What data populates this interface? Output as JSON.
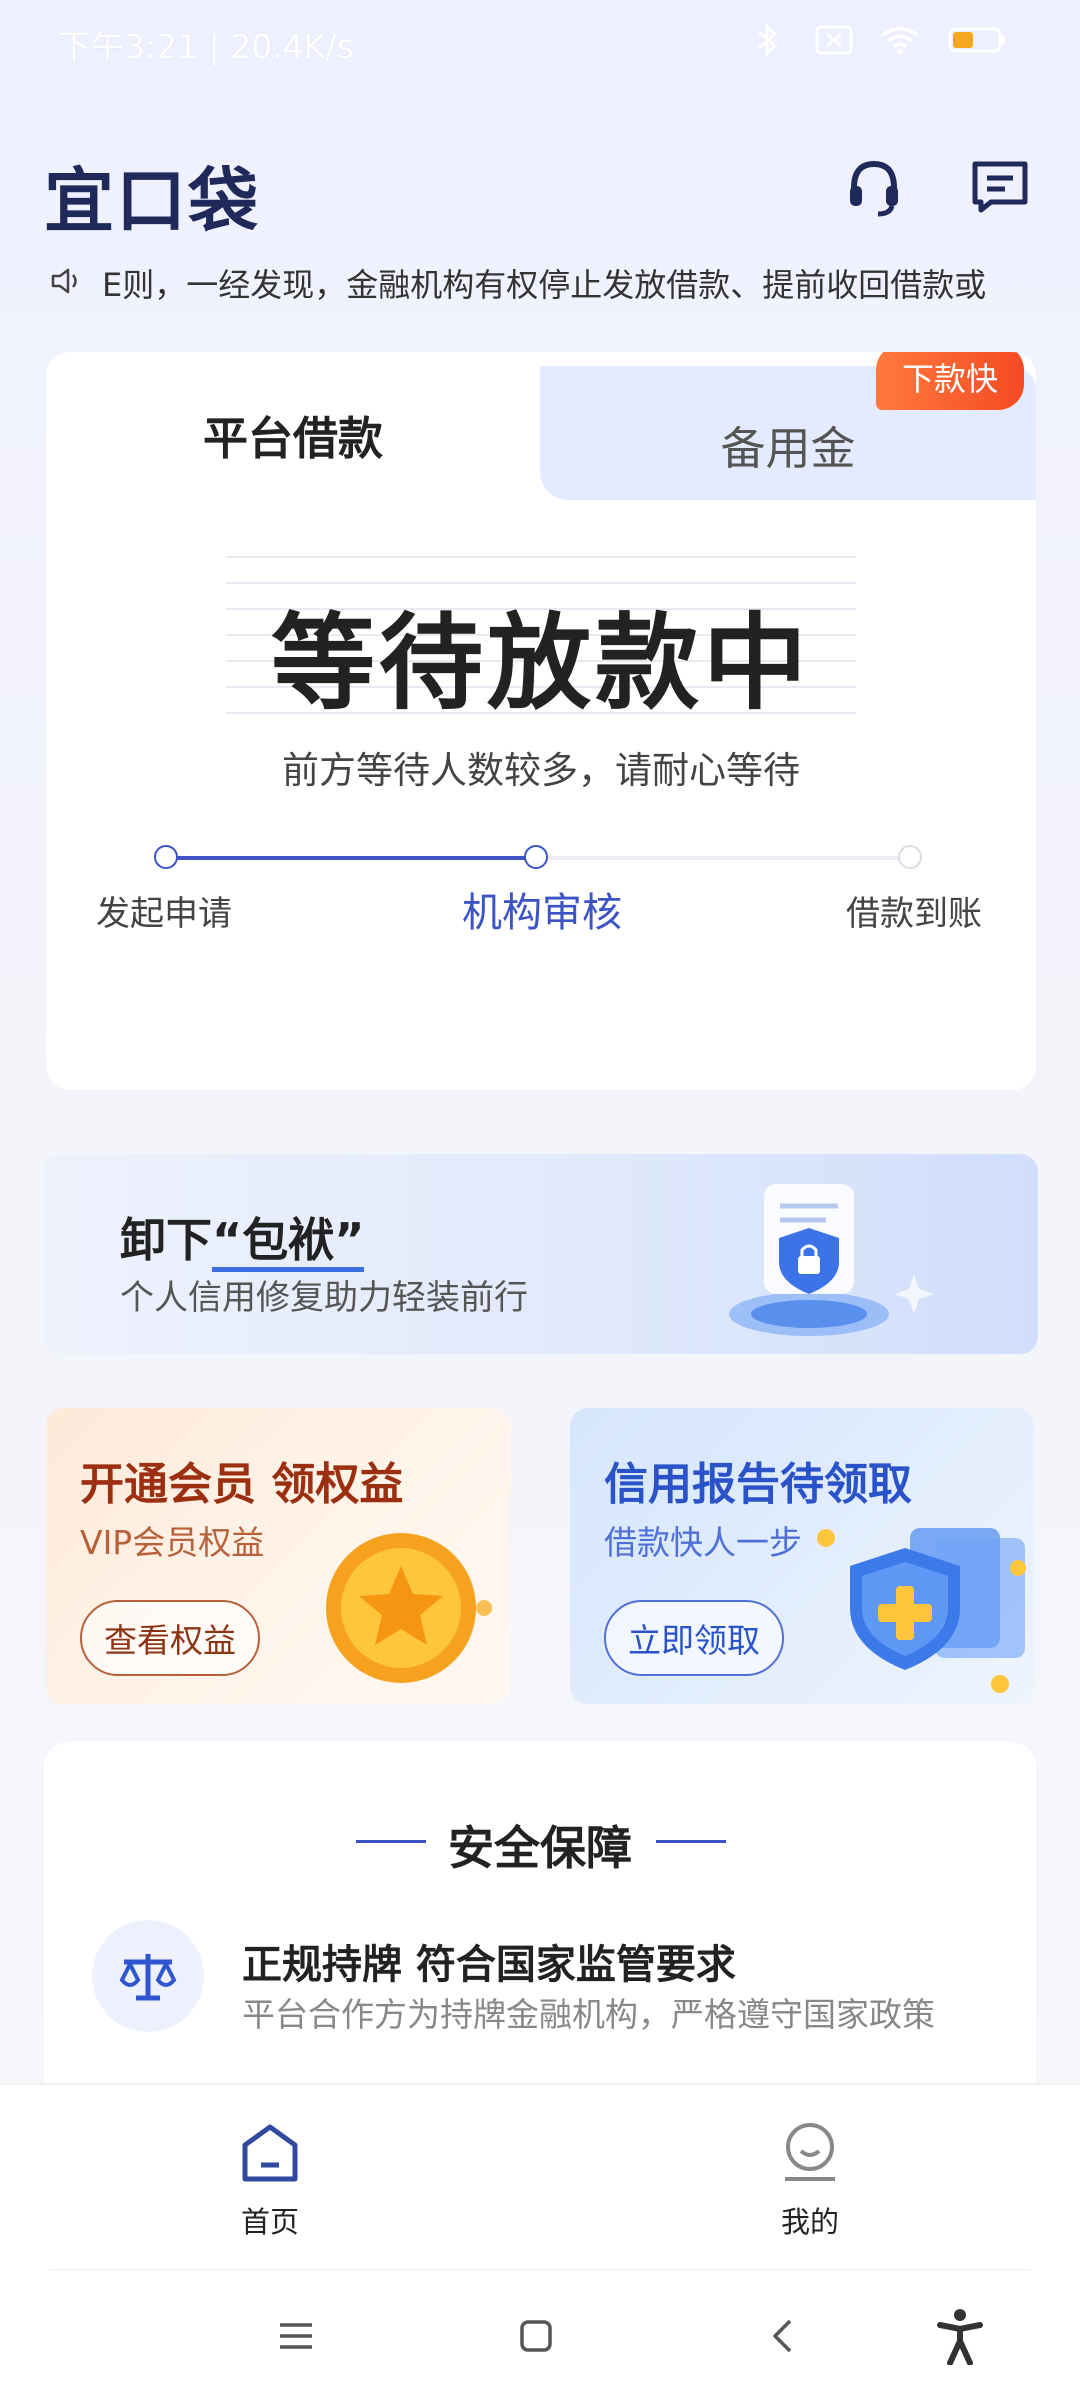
{
  "status_bar": {
    "time": "下午3:21 | 20.4K/s",
    "battery": "45"
  },
  "header": {
    "logo": "宜口袋"
  },
  "notice": {
    "text": "E则，一经发现，金融机构有权停止发放借款、提前收回借款或"
  },
  "loan_card": {
    "tabs": [
      {
        "label": "平台借款"
      },
      {
        "label": "备用金"
      }
    ],
    "badge": "下款快",
    "status_title": "等待放款中",
    "status_sub": "前方等待人数较多，请耐心等待",
    "steps": [
      {
        "label": "发起申请"
      },
      {
        "label": "机构审核"
      },
      {
        "label": "借款到账"
      }
    ],
    "current_step": 2
  },
  "banner": {
    "title_prefix": "卸下",
    "title_quote": "“包袱”",
    "subtitle": "个人信用修复助力轻装前行"
  },
  "promos": [
    {
      "title": "开通会员 领权益",
      "subtitle": "VIP会员权益",
      "button": "查看权益"
    },
    {
      "title": "信用报告待领取",
      "subtitle": "借款快人一步",
      "button": "立即领取"
    }
  ],
  "safety": {
    "heading": "安全保障",
    "row_title": "正规持牌 符合国家监管要求",
    "row_desc": "平台合作方为持牌金融机构，严格遵守国家政策"
  },
  "nav": {
    "items": [
      {
        "label": "首页"
      },
      {
        "label": "我的"
      }
    ]
  },
  "colors": {
    "accent": "#3b53c4",
    "badge": "#f54a24",
    "logo": "#1f2a5a"
  }
}
